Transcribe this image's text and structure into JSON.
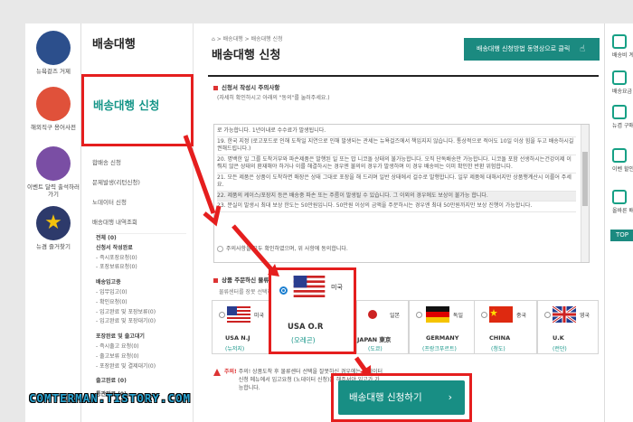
{
  "leftbar": [
    {
      "label": "뉴욕겉즈 거제",
      "icon": "gift-icon"
    },
    {
      "label": "해외직구 용어사전",
      "icon": "dictionary-icon"
    },
    {
      "label": "이벤트 달력 출석하러 가기",
      "icon": "calendar-icon"
    },
    {
      "label": "뉴겸 즐거찾기",
      "icon": "star-icon"
    }
  ],
  "sidenav": {
    "title": "배송대행",
    "active": "배송대행 신청",
    "links": [
      "합배송 신청",
      "문제발생(리턴신청)",
      "노데이터 신청",
      "배송대행 내역조회"
    ],
    "sub": [
      {
        "text": "전체 (0)",
        "head": true
      },
      {
        "text": "신청서 작성완료",
        "head": true
      },
      {
        "text": "- 즉시포장요청(0)"
      },
      {
        "text": "- 포장보류요청(0)"
      },
      {
        "text": "",
        "head": false
      },
      {
        "text": "배송입고중",
        "head": true
      },
      {
        "text": "- 입무입고(0)"
      },
      {
        "text": "- 확인요청(0)"
      },
      {
        "text": "- 입고완료 및 포장보류(0)"
      },
      {
        "text": "- 입고완료 및 포장대기(0)"
      },
      {
        "text": "",
        "head": false
      },
      {
        "text": "포장완료 및 출고대기",
        "head": true
      },
      {
        "text": "- 즉시출고 요청(0)"
      },
      {
        "text": "- 출고보류 요청(0)"
      },
      {
        "text": "- 포장완료 및 결제대기(0)"
      },
      {
        "text": "",
        "head": false
      },
      {
        "text": "출고완료 (0)",
        "head": true
      },
      {
        "text": "",
        "head": false
      },
      {
        "text": "통관완료 (0)",
        "head": true
      }
    ]
  },
  "main": {
    "breadcrumb": "⌂ > 배송대행 > 배송대행 신청",
    "title": "배송대행 신청",
    "video_button": "배송대행 신청방법 동영상으로 클릭",
    "notice_header": "신청서 작성시 주의사항",
    "notice_sub": "(자세히 확인하시고 아래의 \"동의\"를 눌러주세요.)",
    "notice_lines": [
      "로 가능합니다. 1년이내로 수수료가 발생됩니다.",
      "19. 한국 지정 (로고포드로 인해 도착일 지연으로 인해 발생되는 관세는 뉴욕걸즈에서 책임지지 않습니다. 통상적으로 적어도 10일 이상 힘을 두고 배송하시길 권해드립니다.)",
      "20. 명백한 일 그를 도착거부와 파손제품은 발행된 일 또는 밥 니코돌 상태의 불가능합니다. 오직 단독배송만 가능합니다. 니코돌 포함 선생하시는건강이제 이뤄지 않은 상태의 환재해야 하거나 이를 해결하시는 경우엔 불의의 경우가 발생하며 이 경우 배송비는 이미 확인한 반환 위험합니다.",
      "21. 모든 제품은 상품이 도착하면 매장은 상태 그대로 포장을 해 드리며 일반 상태에서 걸수로 발행합니다. 일부 제품에 대해서지만 상품행계산시 이룰어 주세요.",
      "22. 제품의 케이스/포장지 등은 배송중 파손 또는 주름이 발생될 수 있습니다. 그 이외의 경우에도 보상이 불가능 합니다.",
      "23. 분실이 발생시 최대 보상 한도는 50만원입니다. 50만원 이상의 금액을 주문하시는 경우엔 최대 50만원까지만 보상 진행이 가능합니다."
    ],
    "agree_text": "주의사항을 모두 확인하였으며, 위 사항에 동의합니다.",
    "center_header": "상품 주문하신 물류센터 위치를 선택해주세요.",
    "center_sub": "물류센터를 장못 선택하시면 입고처리가 늦어질 수 있습니다.",
    "centers": [
      {
        "country": "미국",
        "warehouse": "USA N.J",
        "location": "(뉴저지)",
        "flag": "us"
      },
      {
        "country": "미국",
        "warehouse": "USA O.R",
        "location": "(오레곤)",
        "flag": "us"
      },
      {
        "country": "일본",
        "warehouse": "JAPAN 東京",
        "location": "(도쿄)",
        "flag": "jp"
      },
      {
        "country": "독일",
        "warehouse": "GERMANY",
        "location": "(프랑크푸르트)",
        "flag": "de"
      },
      {
        "country": "중국",
        "warehouse": "CHINA",
        "location": "(청도)",
        "flag": "cn"
      },
      {
        "country": "영국",
        "warehouse": "U.K",
        "location": "(런던)",
        "flag": "uk"
      }
    ],
    "warning": "주의! 상품도착 후 물류센터 선택을 잘못하신 경우에는 노데이터 신청 메뉴에서 입고요청 (노데이터 신청)을 해주셔야 입고가 가능합니다.",
    "warning_prefix": "주의!",
    "submit": "배송대행 신청하기"
  },
  "rightbar": [
    {
      "label": "배송비 계",
      "icon": "calculator-icon"
    },
    {
      "label": "배송요금",
      "icon": "fee-icon"
    },
    {
      "label": "뉴겸 구매 신청",
      "icon": "cart-icon"
    },
    {
      "label": "이벤 할인쿠",
      "icon": "coupon-icon"
    },
    {
      "label": "올바른 배 신청",
      "icon": "check-icon"
    }
  ],
  "rightbar_top": "TOP",
  "watermark": "COMTERMAN.TISTORY.COM",
  "colors": {
    "accent": "#1b8a80",
    "highlight": "#e51e1e",
    "link": "#159588"
  }
}
